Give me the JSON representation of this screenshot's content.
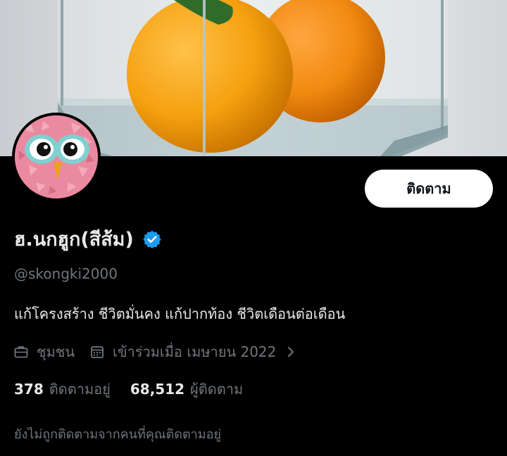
{
  "profile": {
    "display_name": "ฮ.นกฮูก(สีส้ม)",
    "handle": "@skongki2000",
    "bio": "แก้โครงสร้าง ชีวิตมั่นคง แก้ปากท้อง ชีวิตเดือนต่อเดือน",
    "verified": true,
    "verified_color": "#1d9bf0"
  },
  "actions": {
    "follow_label": "ติดตาม"
  },
  "meta": {
    "category_label": "ชุมชน",
    "category_icon": "briefcase-icon",
    "joined_label": "เข้าร่วมเมื่อ เมษายน 2022",
    "joined_icon": "calendar-icon"
  },
  "stats": {
    "following_count": "378",
    "following_label": "ติดตามอยู่",
    "followers_count": "68,512",
    "followers_label": "ผู้ติดตาม"
  },
  "followed_by_note": "ยังไม่ถูกติดตามจากคนที่คุณติดตามอยู่"
}
